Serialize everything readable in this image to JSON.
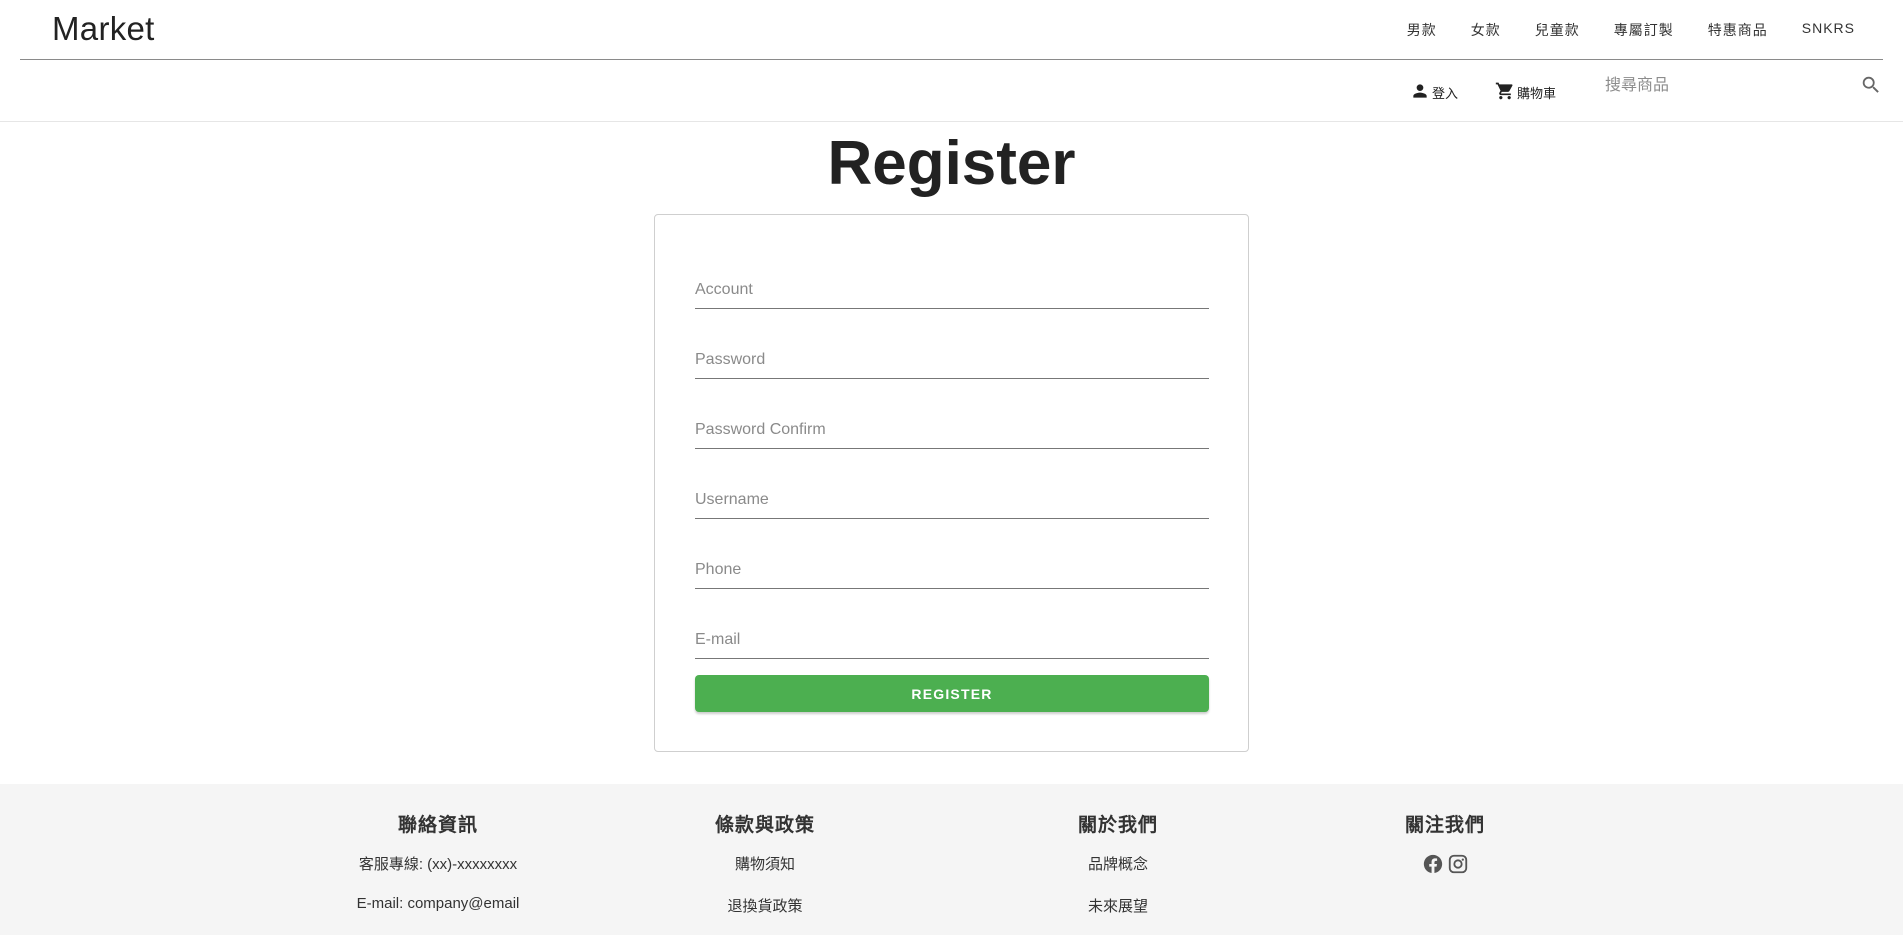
{
  "header": {
    "brand": "Market",
    "categories": [
      "男款",
      "女款",
      "兒童款",
      "專屬訂製",
      "特惠商品",
      "SNKRS"
    ],
    "login_label": "登入",
    "cart_label": "購物車",
    "search_placeholder": "搜尋商品",
    "icons": {
      "login": "person-icon",
      "cart": "cart-icon",
      "search": "search-icon"
    }
  },
  "main": {
    "title": "Register",
    "fields": [
      {
        "placeholder": "Account",
        "value": ""
      },
      {
        "placeholder": "Password",
        "value": ""
      },
      {
        "placeholder": "Password Confirm",
        "value": ""
      },
      {
        "placeholder": "Username",
        "value": ""
      },
      {
        "placeholder": "Phone",
        "value": ""
      },
      {
        "placeholder": "E-mail",
        "value": ""
      }
    ],
    "submit_label": "REGISTER",
    "accent_color": "#4caf50"
  },
  "footer": {
    "columns": [
      {
        "heading": "聯絡資訊",
        "links": [
          "客服專線: (xx)-xxxxxxxx",
          "E-mail: company@email"
        ]
      },
      {
        "heading": "條款與政策",
        "links": [
          "購物須知",
          "退換貨政策"
        ]
      },
      {
        "heading": "關於我們",
        "links": [
          "品牌概念",
          "未來展望"
        ]
      },
      {
        "heading": "關注我們",
        "social": [
          "facebook-icon",
          "instagram-icon"
        ]
      }
    ]
  }
}
